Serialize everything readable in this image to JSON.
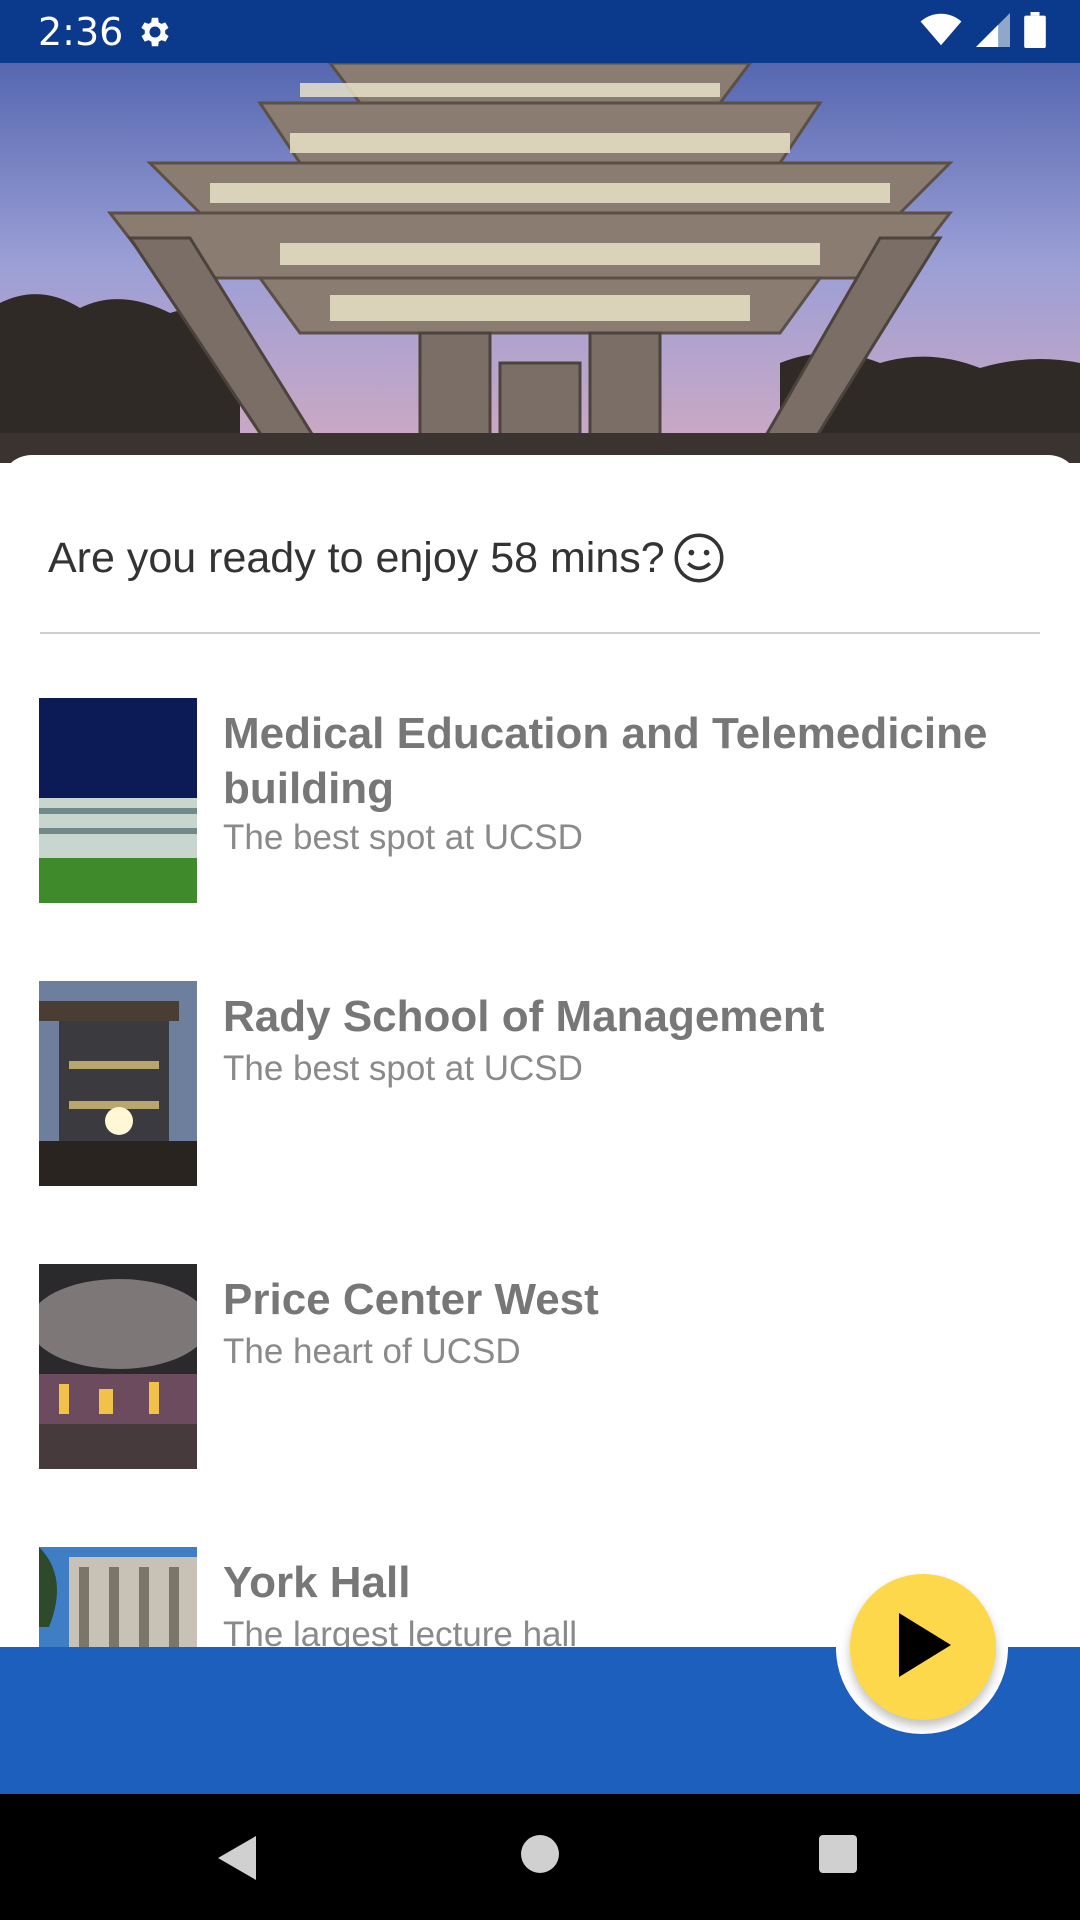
{
  "status_bar": {
    "time": "2:36",
    "icons": [
      "gear-icon",
      "wifi-icon",
      "cell-signal-icon",
      "battery-icon"
    ],
    "background": "#0b3a8c"
  },
  "hero": {
    "image": "geisel-library-photo"
  },
  "prompt": {
    "text": "Are you ready to enjoy 58 mins?",
    "icon": "smiley-icon"
  },
  "places": [
    {
      "title": "Medical Education and Telemedicine building",
      "subtitle": "The best spot at UCSD",
      "thumb": "medical-education-building-photo"
    },
    {
      "title": "Rady School of Management",
      "subtitle": "The best spot at UCSD",
      "thumb": "rady-school-photo"
    },
    {
      "title": "Price Center West",
      "subtitle": "The heart of UCSD",
      "thumb": "price-center-photo"
    },
    {
      "title": "York Hall",
      "subtitle": "The largest lecture hall",
      "thumb": "york-hall-photo"
    }
  ],
  "fab": {
    "icon": "play-icon",
    "color": "#fdd84a"
  },
  "bottom_bar": {
    "color": "#1c5fbd"
  },
  "nav_bar": {
    "icons": [
      "back-icon",
      "home-icon",
      "recents-icon"
    ]
  }
}
